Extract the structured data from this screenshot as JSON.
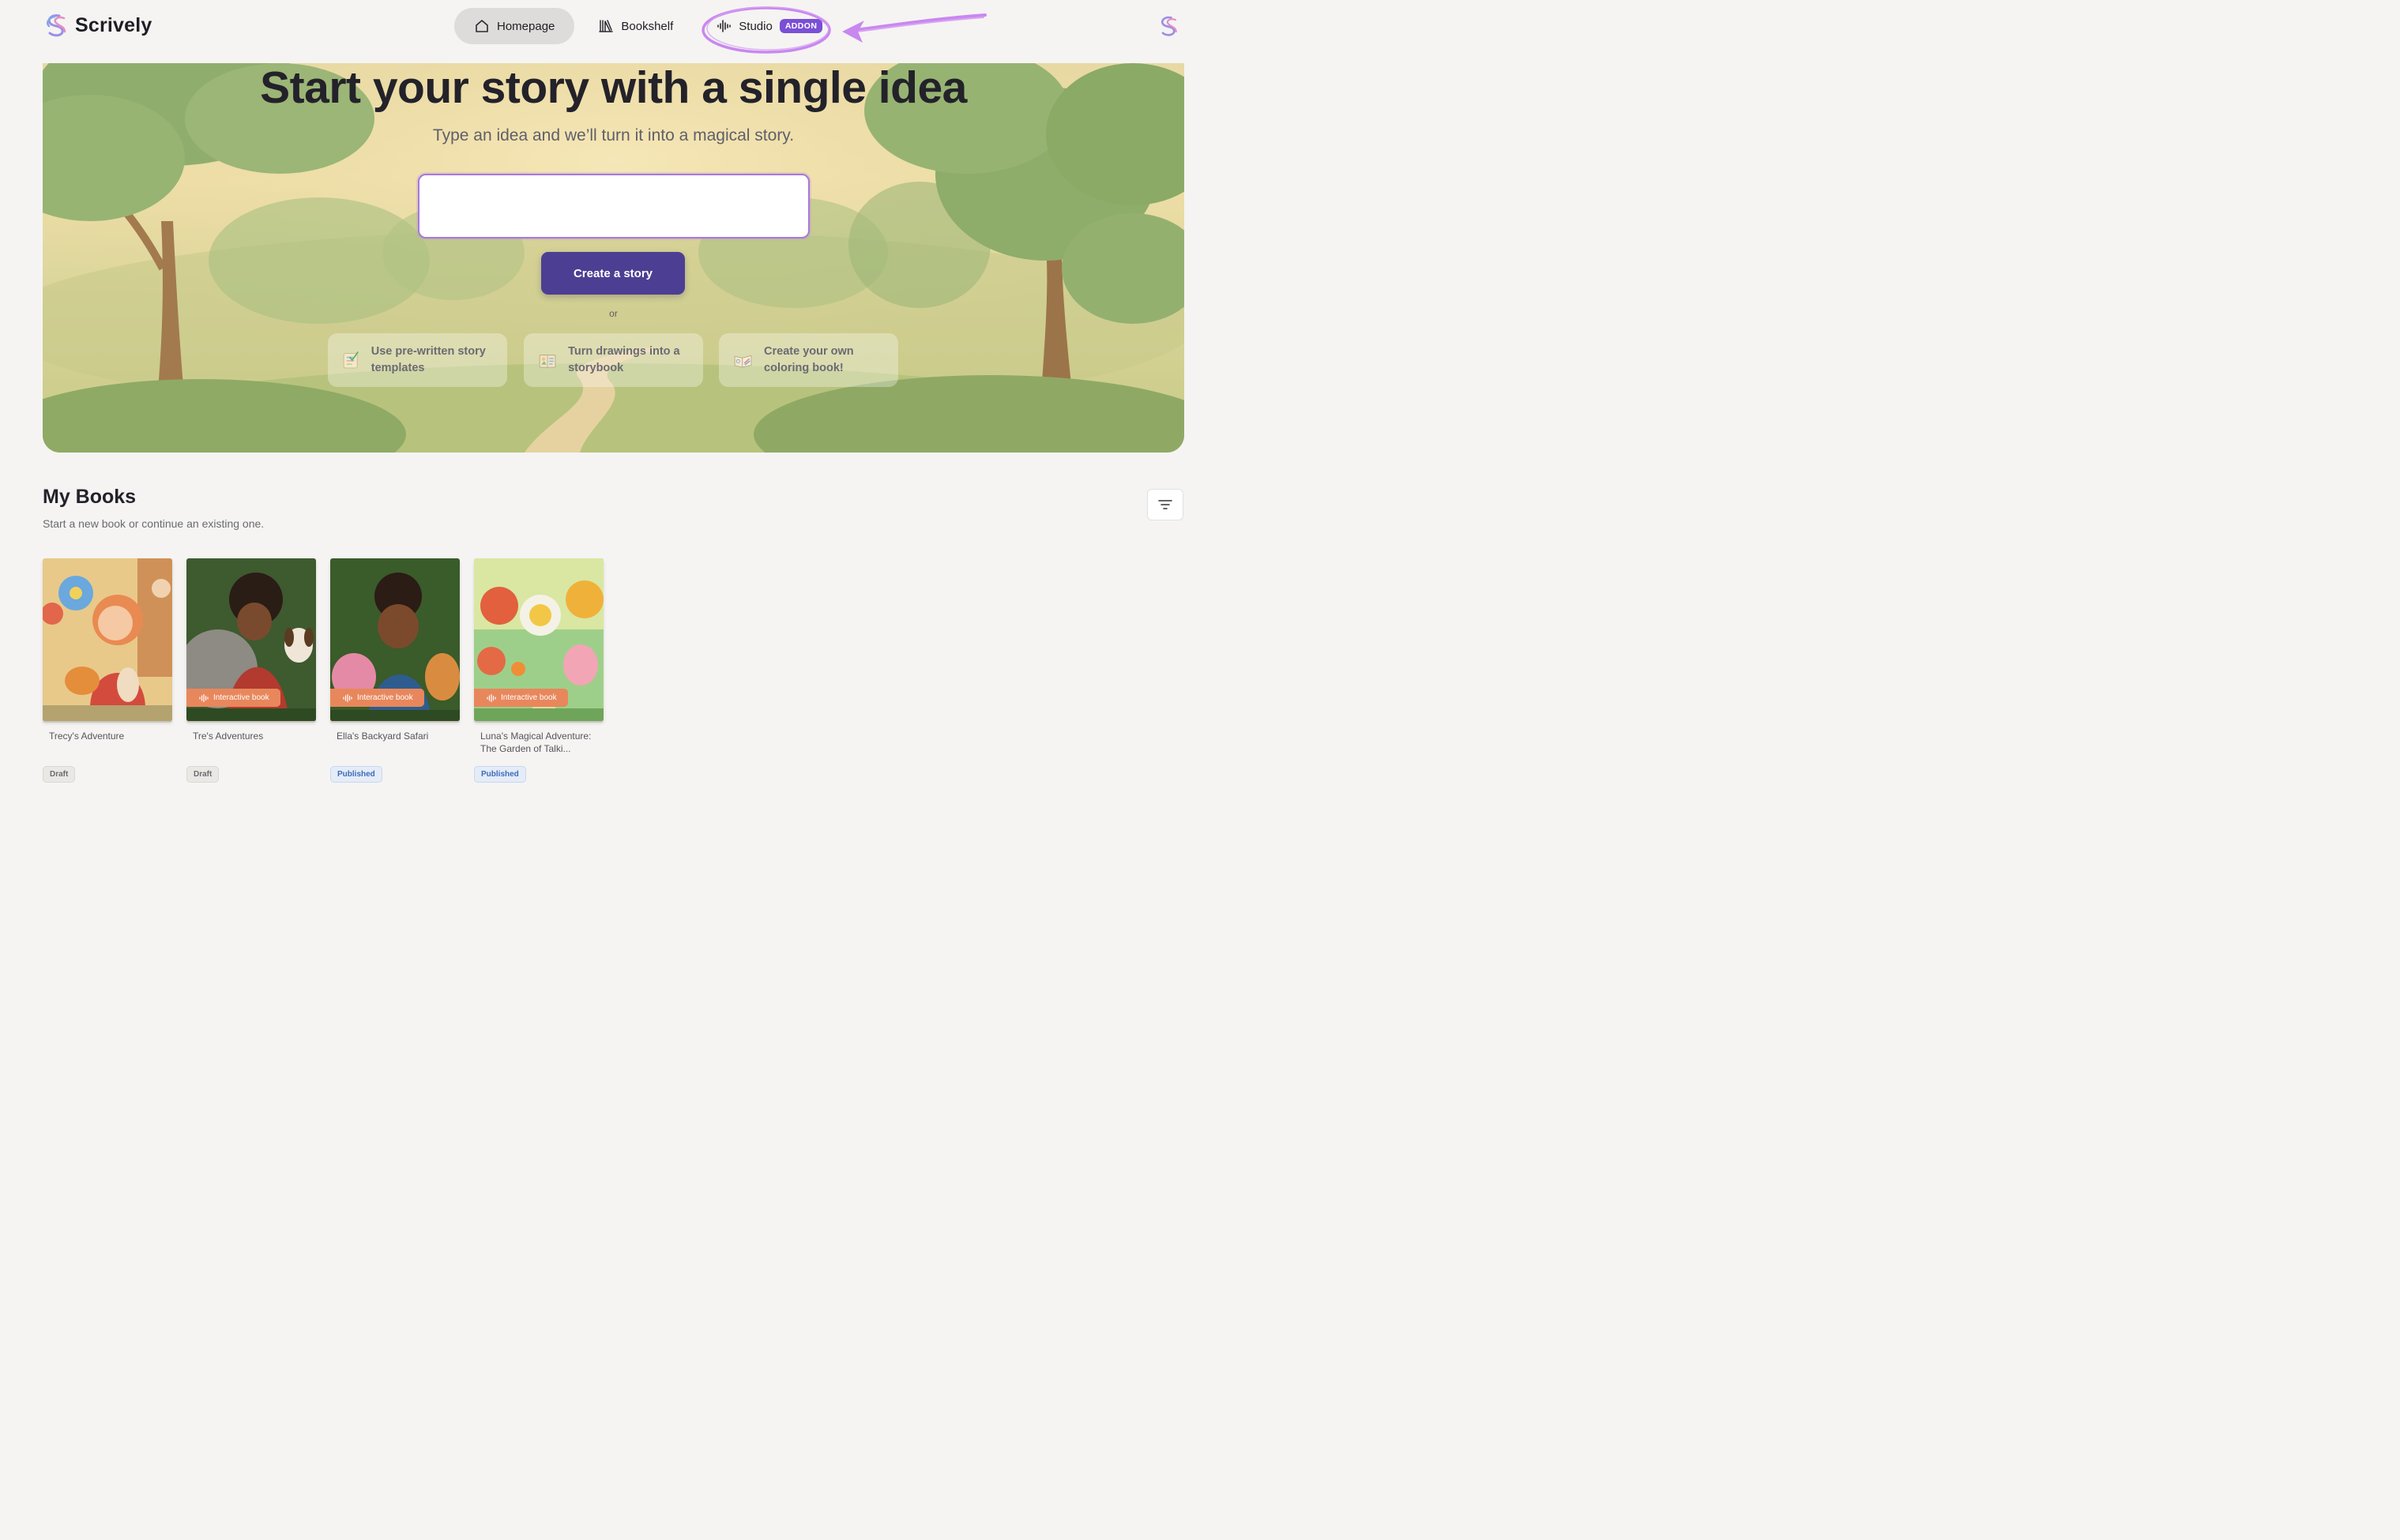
{
  "brand": {
    "name": "Scrively",
    "accent": "#7a6fd8"
  },
  "nav": {
    "homepage": "Homepage",
    "bookshelf": "Bookshelf",
    "studio": "Studio",
    "studio_badge": "ADDON"
  },
  "hero": {
    "title": "Start your story with a single idea",
    "subtitle": "Type an idea and we’ll turn it into a magical story.",
    "input_value": "",
    "create_label": "Create a story",
    "or_text": "or",
    "options": [
      {
        "label": "Use pre-written story templates",
        "icon": "template-checklist-icon"
      },
      {
        "label": "Turn drawings into a storybook",
        "icon": "drawing-book-icon"
      },
      {
        "label": "Create your own coloring book!",
        "icon": "coloring-book-icon"
      }
    ]
  },
  "books_section": {
    "title": "My Books",
    "subtitle": "Start a new book or continue an existing one.",
    "interactive_label": "Interactive book",
    "books": [
      {
        "title": "Trecy's Adventure",
        "status": "Draft",
        "interactive": false
      },
      {
        "title": "Tre's Adventures",
        "status": "Draft",
        "interactive": true
      },
      {
        "title": "Ella's Backyard Safari",
        "status": "Published",
        "interactive": true
      },
      {
        "title": "Luna's Magical Adventure: The Garden of Talki...",
        "status": "Published",
        "interactive": true
      }
    ]
  },
  "colors": {
    "primary_button": "#4c3f93",
    "addon_badge": "#7a4fd6",
    "annotation": "#c987f0",
    "interactive_tag": "#e8875c",
    "published": "#3f6bb8"
  }
}
